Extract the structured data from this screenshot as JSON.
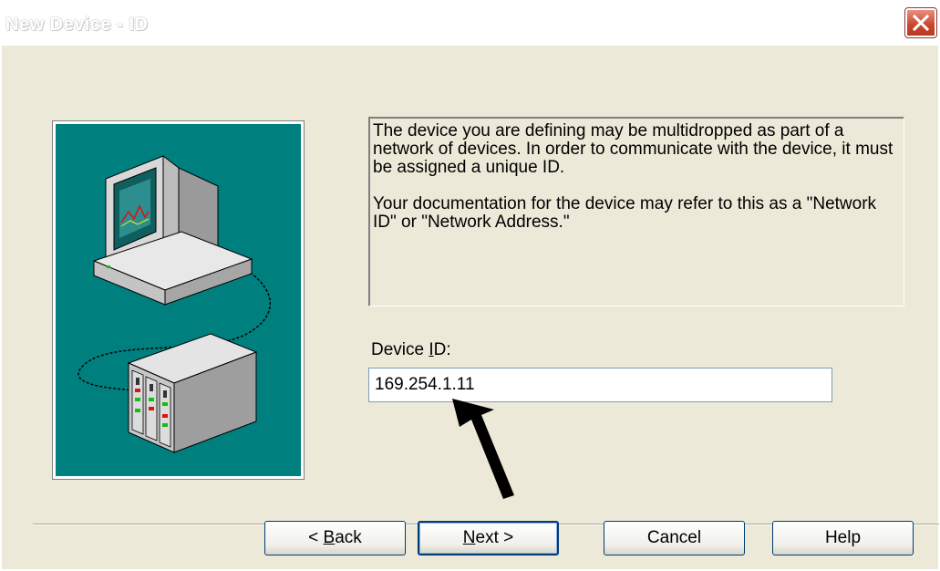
{
  "window": {
    "title": "New Device - ID"
  },
  "description": {
    "paragraph1": "The device you are defining may be multidropped as part of a network of devices.  In order to communicate with the device, it must be assigned a unique ID.",
    "paragraph2": "Your documentation for the device may refer to this as a \"Network ID\" or \"Network Address.\""
  },
  "device_id": {
    "label_pre": "Device ",
    "label_mnemonic": "I",
    "label_post": "D:",
    "value": "169.254.1.11"
  },
  "buttons": {
    "back_pre": "< ",
    "back_mnemonic": "B",
    "back_post": "ack",
    "next_mnemonic": "N",
    "next_post": "ext >",
    "cancel": "Cancel",
    "help": "Help"
  },
  "icons": {
    "close": "close-icon",
    "illustration": "computer-network-illustration",
    "arrow": "annotation-arrow"
  },
  "colors": {
    "panel_teal": "#007f7f",
    "dialog_bg": "#ece9d8",
    "close_red": "#c9452c"
  }
}
